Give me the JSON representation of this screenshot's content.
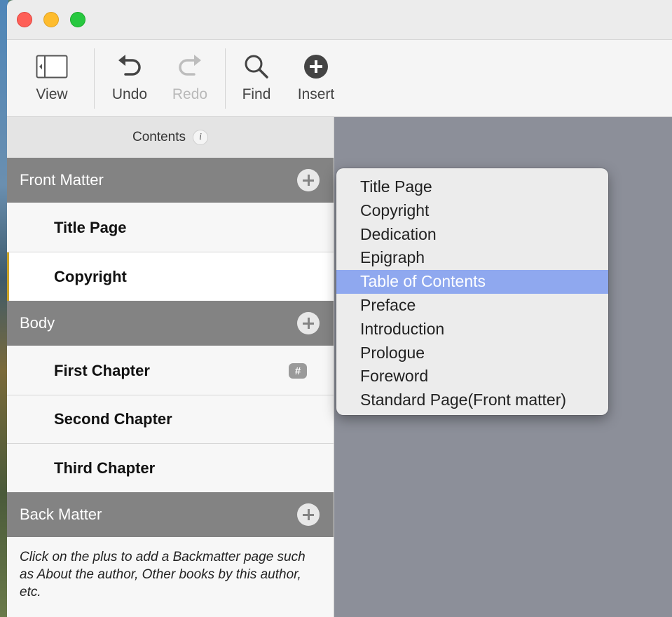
{
  "toolbar": {
    "view_label": "View",
    "undo_label": "Undo",
    "redo_label": "Redo",
    "find_label": "Find",
    "insert_label": "Insert"
  },
  "sidebar": {
    "header": "Contents",
    "info_glyph": "i",
    "sections": {
      "front_matter": {
        "title": "Front Matter",
        "items": [
          "Title Page",
          "Copyright"
        ]
      },
      "body": {
        "title": "Body",
        "items": [
          "First Chapter",
          "Second Chapter",
          "Third Chapter"
        ],
        "numbered_badge": "#"
      },
      "back_matter": {
        "title": "Back Matter",
        "hint": "Click on the plus to add a Backmatter page such as About the author, Other books by this author, etc."
      }
    },
    "selected_item": "Copyright"
  },
  "menu": {
    "items": [
      "Title Page",
      "Copyright",
      "Dedication",
      "Epigraph",
      "Table of Contents",
      "Preface",
      "Introduction",
      "Prologue",
      "Foreword",
      "Standard Page(Front matter)"
    ],
    "highlighted": "Table of Contents"
  },
  "colors": {
    "section_header": "#838383",
    "menu_highlight": "#8fa8ef",
    "canvas": "#8c8f99"
  }
}
